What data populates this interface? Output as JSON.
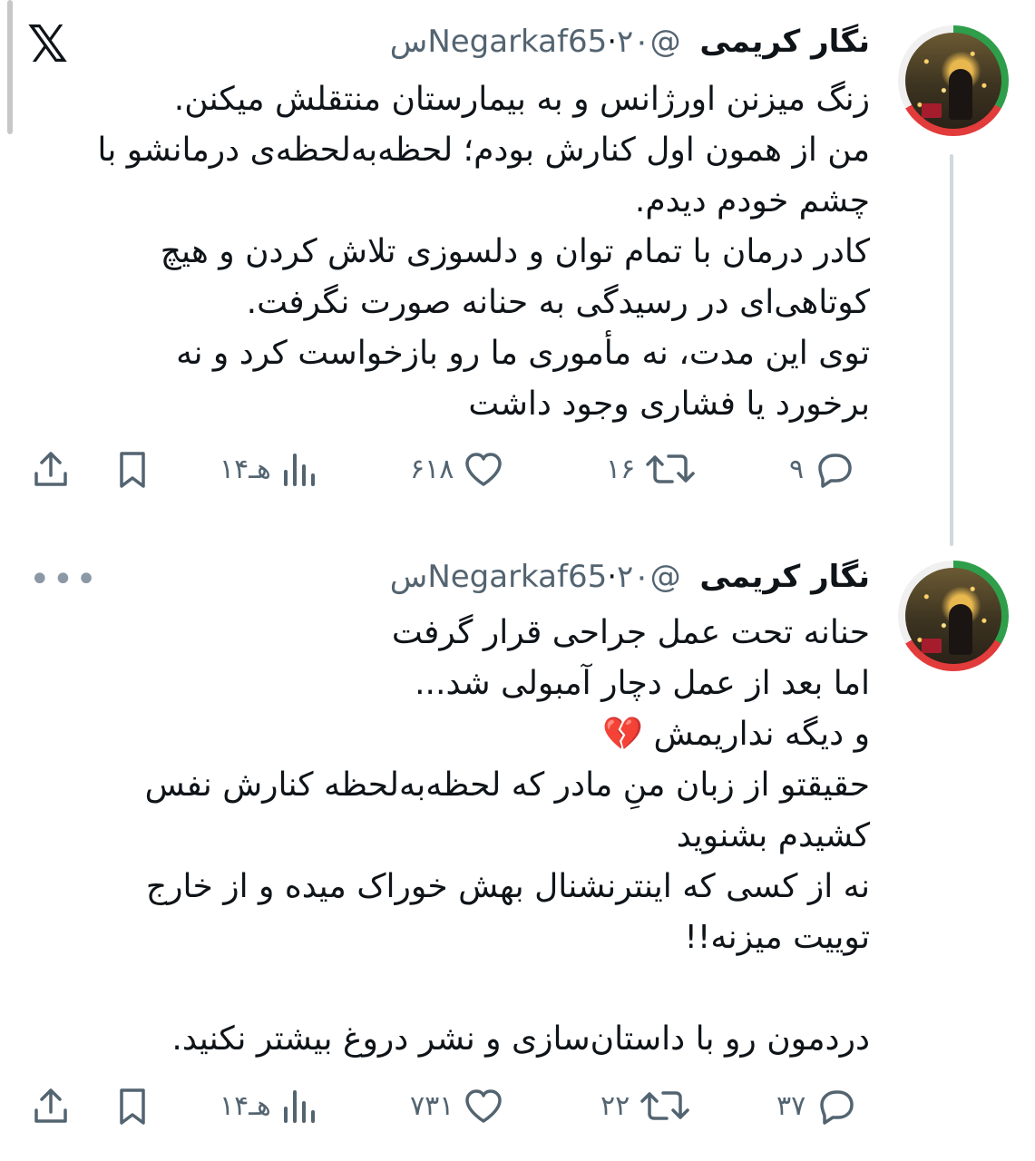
{
  "app": {
    "logo": "𝕏"
  },
  "tweets": [
    {
      "name": "نگار کریمی",
      "handle": "@Negarkaf65",
      "time": "۲۰س",
      "lines": [
        "زنگ میزنن اورژانس و به بیمارستان منتقلش میکنن.",
        "من از همون اول کنارش بودم؛ لحظه‌به‌لحظه‌ی درمانشو با",
        "چشم خودم دیدم.",
        "کادر درمان با تمام توان و دلسوزی تلاش کردن و هیچ",
        "کوتاهی‌ای در رسیدگی به حنانه صورت نگرفت.",
        "توی این مدت، نه مأموری ما رو بازخواست کرد و نه",
        "برخورد یا فشاری وجود داشت"
      ],
      "replies": "۹",
      "reposts": "۱۶",
      "likes": "۶۱۸",
      "views": "۱۴هـ"
    },
    {
      "name": "نگار کریمی",
      "handle": "@Negarkaf65",
      "time": "۲۰س",
      "more": "•••",
      "lines": [
        "حنانه تحت عمل جراحی قرار گرفت",
        "اما بعد از عمل دچار آمبولی شد...",
        "و دیگه نداریمش 💔",
        "حقیقتو از زبان منِ مادر که لحظه‌به‌لحظه کنارش نفس",
        "کشیدم بشنوید",
        "نه از کسی که اینترنشنال بهش خوراک میده و از خارج",
        "توییت میزنه!!",
        "",
        "دردمون رو با داستان‌سازی و نشر دروغ بیشتر نکنید."
      ],
      "replies": "۳۷",
      "reposts": "۲۲",
      "likes": "۷۳۱",
      "views": "۱۴هـ"
    }
  ],
  "icons": [
    "x-logo",
    "reply-icon",
    "repost-icon",
    "like-icon",
    "views-icon",
    "bookmark-icon",
    "share-icon",
    "more-icon"
  ]
}
